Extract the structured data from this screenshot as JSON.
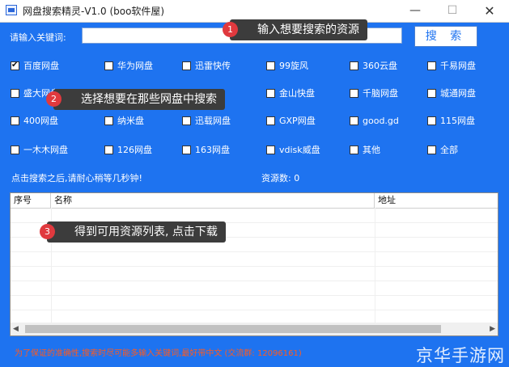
{
  "window": {
    "title": "网盘搜索精灵-V1.0  (boo软件屋)",
    "min_glyph": "—",
    "max_glyph": "☐",
    "close_glyph": "✕"
  },
  "search": {
    "label": "请输入关键词:",
    "value": "",
    "button": "搜 索"
  },
  "disks": {
    "row1": [
      {
        "label": "百度网盘",
        "checked": true
      },
      {
        "label": "华为网盘",
        "checked": false
      },
      {
        "label": "迅雷快传",
        "checked": false
      },
      {
        "label": "99旋风",
        "checked": false
      },
      {
        "label": "360云盘",
        "checked": false
      },
      {
        "label": "千易网盘",
        "checked": false
      }
    ],
    "row2": [
      {
        "label": "盛大网盘",
        "checked": false
      },
      {
        "label": "金山快盘",
        "checked": false
      },
      {
        "label": "千脑网盘",
        "checked": false
      },
      {
        "label": "城通网盘",
        "checked": false
      }
    ],
    "row3": [
      {
        "label": "400网盘",
        "checked": false
      },
      {
        "label": "纳米盘",
        "checked": false
      },
      {
        "label": "迅载网盘",
        "checked": false
      },
      {
        "label": "GXP网盘",
        "checked": false
      },
      {
        "label": "good.gd",
        "checked": false
      },
      {
        "label": "115网盘",
        "checked": false
      }
    ],
    "row4": [
      {
        "label": "一木木网盘",
        "checked": false
      },
      {
        "label": "126网盘",
        "checked": false
      },
      {
        "label": "163网盘",
        "checked": false
      },
      {
        "label": "vdisk威盘",
        "checked": false
      },
      {
        "label": "其他",
        "checked": false
      },
      {
        "label": "全部",
        "checked": false
      }
    ]
  },
  "status": {
    "hint": "点击搜索之后,请耐心稍等几秒钟!",
    "count": "资源数: 0"
  },
  "table": {
    "columns": [
      "序号",
      "名称",
      "地址"
    ]
  },
  "scroll": {
    "left": "◀",
    "right": "▶"
  },
  "footer": "为了保证的准确性,搜索时尽可能多输入关键词,最好带中文 (交流群: 12096161)",
  "callouts": [
    {
      "num": "1",
      "text": "输入想要搜索的资源"
    },
    {
      "num": "2",
      "text": "选择想要在那些网盘中搜索"
    },
    {
      "num": "3",
      "text": "得到可用资源列表, 点击下载"
    }
  ],
  "watermark": "京华手游网"
}
